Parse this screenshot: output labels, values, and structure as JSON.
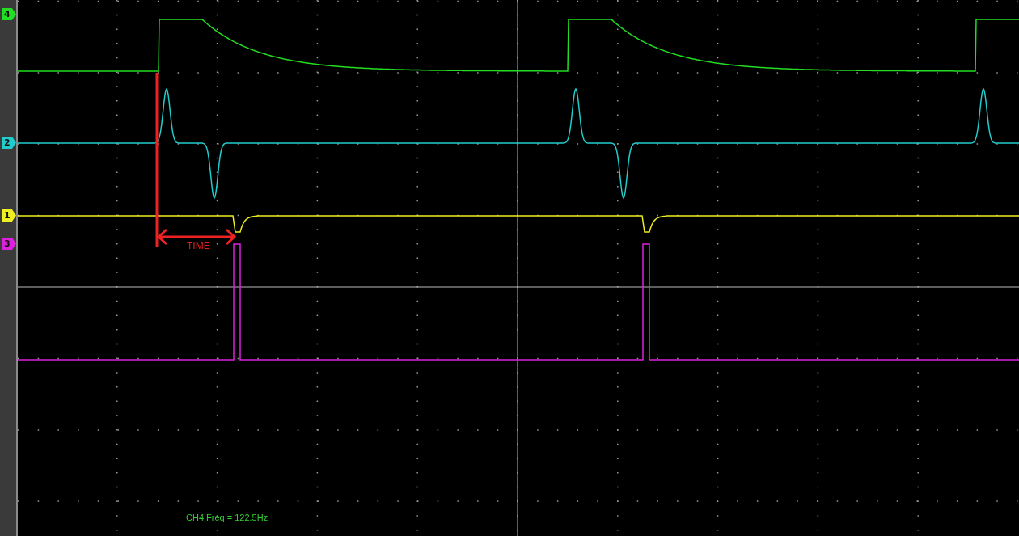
{
  "channels": [
    {
      "label": "4",
      "color": "#22dd22"
    },
    {
      "label": "2",
      "color": "#22cccc"
    },
    {
      "label": "1",
      "color": "#eeee22"
    },
    {
      "label": "3",
      "color": "#dd22dd"
    }
  ],
  "annotation": {
    "label": "TIME"
  },
  "readout": "CH4:Freq = 122.5Hz"
}
